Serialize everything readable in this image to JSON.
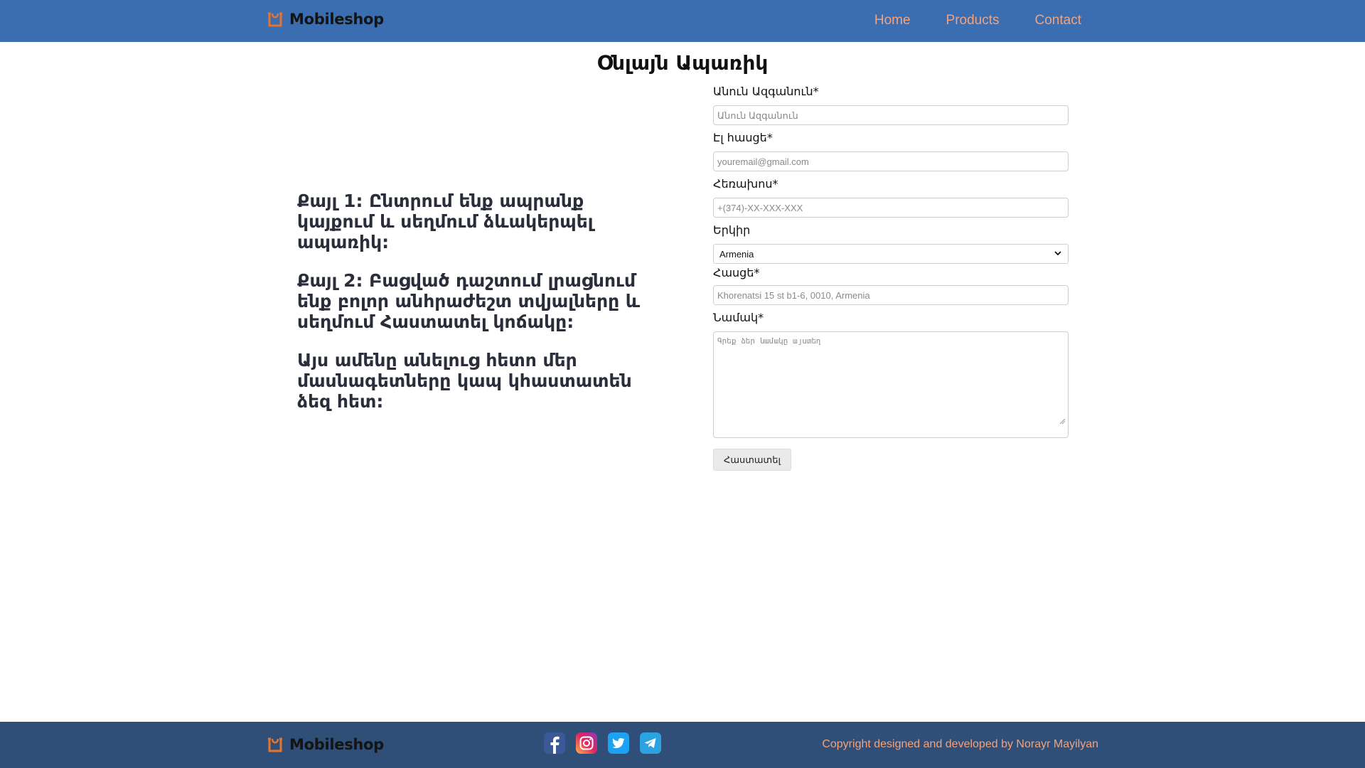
{
  "header": {
    "brand": "Mobileshop",
    "nav": [
      {
        "label": "Home"
      },
      {
        "label": "Products"
      },
      {
        "label": "Contact"
      }
    ]
  },
  "page": {
    "title": "Օնլայն Ապառիկ"
  },
  "steps": [
    "Քայլ 1: Ընտրում ենք ապրանք կայքում և սեղմում ձևակերպել ապառիկ:",
    "Քայլ 2: Բացված դաշտում լրացնում ենք բոլոր անհրաժեշտ տվյալները և սեղմում Հաստատել կոճակը:",
    "Այս ամենը անելուց հետո մեր մասնագետները կապ կհաստատեն ձեզ հետ:"
  ],
  "form": {
    "name": {
      "label": "Անուն Ազգանուն*",
      "placeholder": "Անուն Ազգանուն"
    },
    "email": {
      "label": "Էլ հասցե*",
      "placeholder": "youremail@gmail.com"
    },
    "phone": {
      "label": "Հեռախոս*",
      "placeholder": "+(374)-XX-XXX-XXX"
    },
    "country": {
      "label": "Երկիր",
      "selected": "Armenia"
    },
    "address": {
      "label": "Հասցե*",
      "placeholder": "Khorenatsi 15 st b1-6, 0010, Armenia"
    },
    "message": {
      "label": "Նամակ*",
      "placeholder": "Գրեք ձեր նամակը այստեղ"
    },
    "submit_label": "Հաստատել"
  },
  "footer": {
    "brand": "Mobileshop",
    "socials": [
      {
        "icon": "facebook-icon",
        "color": "#3b5998"
      },
      {
        "icon": "instagram-icon",
        "color": "#d6249f"
      },
      {
        "icon": "twitter-icon",
        "color": "#1da1f2"
      },
      {
        "icon": "telegram-icon",
        "color": "#2aa3e0"
      }
    ],
    "copyright": "Copyright designed and developed by Norayr Mayilyan"
  },
  "colors": {
    "header_bg": "#3a6eb0",
    "footer_bg": "#2f4f78",
    "accent": "#f4a27c",
    "logo_orange": "#e8742c"
  }
}
